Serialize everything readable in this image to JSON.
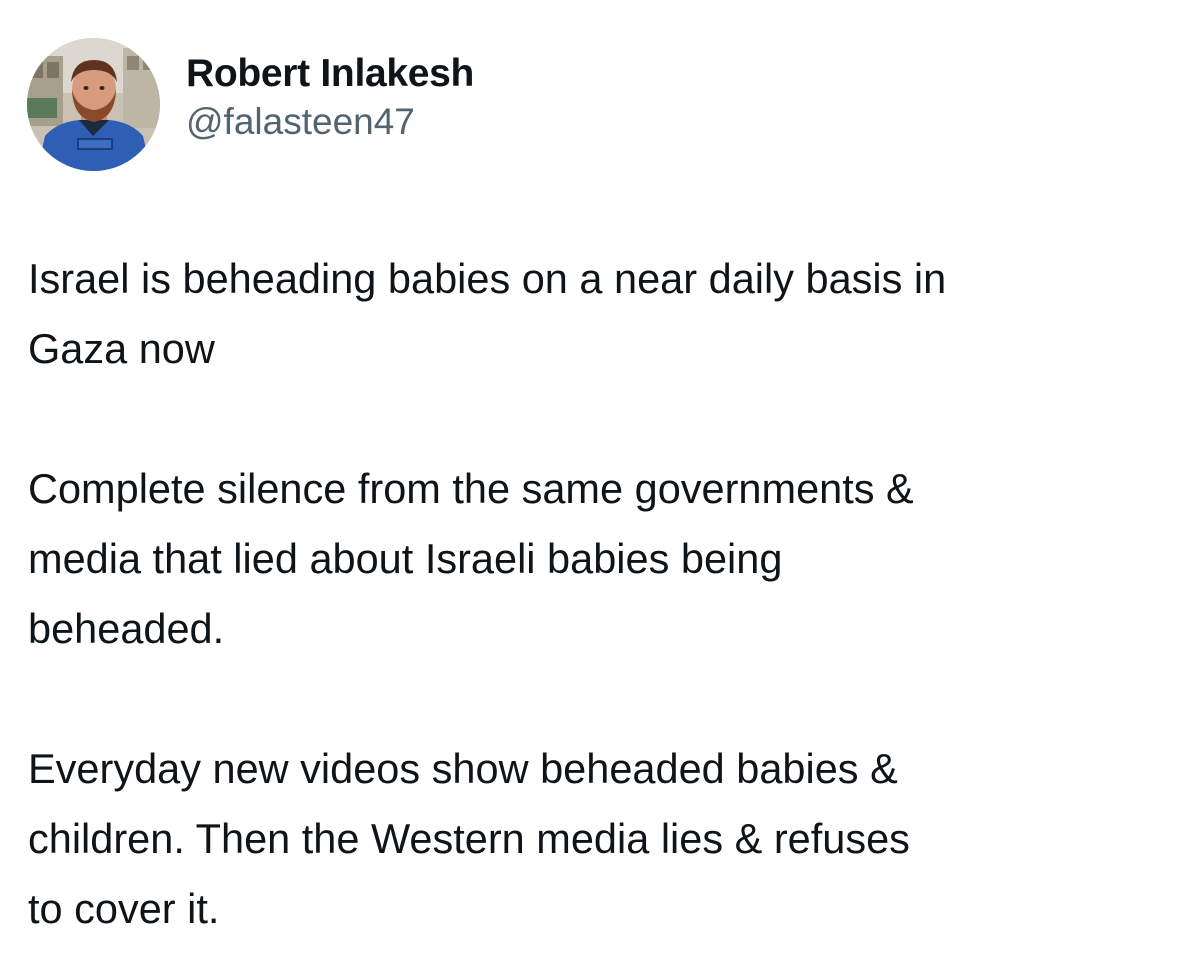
{
  "author": {
    "display_name": "Robert Inlakesh",
    "handle": "@falasteen47",
    "avatar_icon": "profile-photo-avatar"
  },
  "tweet": {
    "paragraphs": [
      [
        "Israel is beheading babies on a near daily basis in",
        "Gaza now"
      ],
      [
        "Complete silence from the same governments &",
        "media that lied about Israeli babies being",
        "beheaded."
      ],
      [
        "Everyday new videos show beheaded babies &",
        "children. Then the Western media lies & refuses",
        "to cover it."
      ]
    ]
  },
  "colors": {
    "text_primary": "#0f1419",
    "text_secondary": "#536471",
    "background": "#ffffff"
  }
}
